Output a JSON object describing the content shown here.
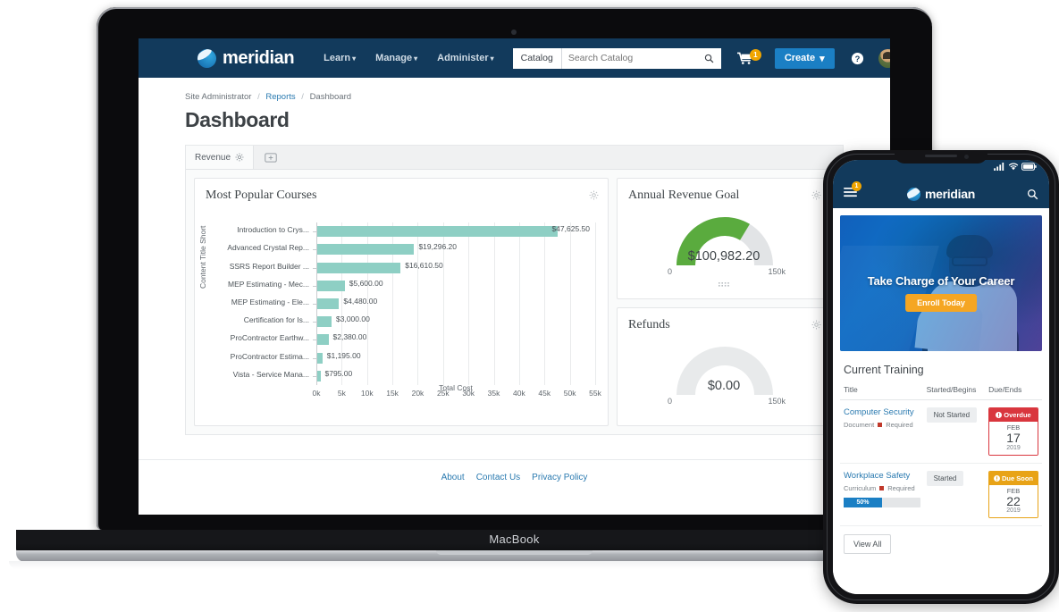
{
  "laptop": {
    "model_label": "MacBook"
  },
  "navbar": {
    "brand": "meridian",
    "links": [
      {
        "label": "Learn",
        "caret": "▾"
      },
      {
        "label": "Manage",
        "caret": "▾"
      },
      {
        "label": "Administer",
        "caret": "▾"
      }
    ],
    "catalog_button": "Catalog",
    "search_placeholder": "Search Catalog",
    "search_value": "",
    "cart_count": "1",
    "create_button": "Create",
    "create_caret": "▾",
    "help_label": "?",
    "avatar_caret": "▾",
    "icons": {
      "search": "search-icon",
      "cart": "cart-icon",
      "help": "help-icon",
      "avatar": "avatar"
    },
    "colors": {
      "bar": "#123a5c",
      "create": "#1b7fc4",
      "badge": "#f0a500"
    }
  },
  "breadcrumb": {
    "items": [
      "Site Administrator",
      "Reports",
      "Dashboard"
    ],
    "separator": "/"
  },
  "page": {
    "title": "Dashboard"
  },
  "tabs": [
    {
      "label": "Revenue",
      "icon": "gear-icon",
      "active": true
    }
  ],
  "tab_add_icon": "add-panel-icon",
  "cards": {
    "courses": {
      "title": "Most Popular Courses",
      "gear": "gear-icon"
    },
    "revenue": {
      "title": "Annual Revenue Goal",
      "gear": "gear-icon",
      "value": "$100,982.20",
      "min": "0",
      "max": "150k",
      "min_num": 0,
      "max_num": 150000,
      "value_num": 100982.2,
      "fill_color": "#5aab3e",
      "track_color": "#e2e4e6"
    },
    "refunds": {
      "title": "Refunds",
      "gear": "gear-icon",
      "value": "$0.00",
      "min": "0",
      "max": "150k",
      "min_num": 0,
      "max_num": 150000,
      "value_num": 0,
      "fill_color": "#5aab3e",
      "track_color": "#e8eaeb"
    }
  },
  "chart_data": {
    "type": "bar",
    "orientation": "horizontal",
    "title": "Most Popular Courses",
    "xlabel": "Total Cost",
    "ylabel": "Content Title Short",
    "categories": [
      "Introduction to Crys...",
      "Advanced Crystal Rep...",
      "SSRS Report Builder ...",
      "MEP Estimating - Mec...",
      "MEP Estimating - Ele...",
      "Certification for Is...",
      "ProContractor Earthw...",
      "ProContractor Estima...",
      "Vista - Service Mana..."
    ],
    "values": [
      47625.5,
      19296.2,
      16610.5,
      5600.0,
      4480.0,
      3000.0,
      2380.0,
      1195.0,
      795.0
    ],
    "value_labels": [
      "$47,625.50",
      "$19,296.20",
      "$16,610.50",
      "$5,600.00",
      "$4,480.00",
      "$3,000.00",
      "$2,380.00",
      "$1,195.00",
      "$795.00"
    ],
    "xticks": [
      "0k",
      "5k",
      "10k",
      "15k",
      "20k",
      "25k",
      "30k",
      "35k",
      "40k",
      "45k",
      "50k",
      "55k"
    ],
    "xtick_values": [
      0,
      5000,
      10000,
      15000,
      20000,
      25000,
      30000,
      35000,
      40000,
      45000,
      50000,
      55000
    ],
    "xlim": [
      0,
      55000
    ],
    "grid": true,
    "legend": false,
    "bar_color": "#8ecfc4"
  },
  "footer": {
    "links": [
      "About",
      "Contact Us",
      "Privacy Policy"
    ]
  },
  "phone": {
    "status": {
      "signal": "signal-icon",
      "wifi": "wifi-icon",
      "battery": "battery-icon"
    },
    "nav": {
      "menu_badge": "1",
      "brand": "meridian",
      "search_icon": "search-icon"
    },
    "hero": {
      "headline": "Take Charge of Your Career",
      "cta": "Enroll Today",
      "cta_color": "#f5a623"
    },
    "training": {
      "title": "Current Training",
      "headers": [
        "Title",
        "Started/Begins",
        "Due/Ends"
      ],
      "rows": [
        {
          "title": "Computer Security",
          "type": "Document",
          "required": "Required",
          "status": "Not Started",
          "progress": null,
          "due_state": "Overdue",
          "due_color": "#d9363e",
          "due_month": "FEB",
          "due_day": "17",
          "due_year": "2019"
        },
        {
          "title": "Workplace Safety",
          "type": "Curriculum",
          "required": "Required",
          "status": "Started",
          "progress": "50%",
          "progress_pct": 50,
          "due_state": "Due Soon",
          "due_color": "#e8a317",
          "due_month": "FEB",
          "due_day": "22",
          "due_year": "2019"
        }
      ],
      "view_all": "View All"
    }
  }
}
